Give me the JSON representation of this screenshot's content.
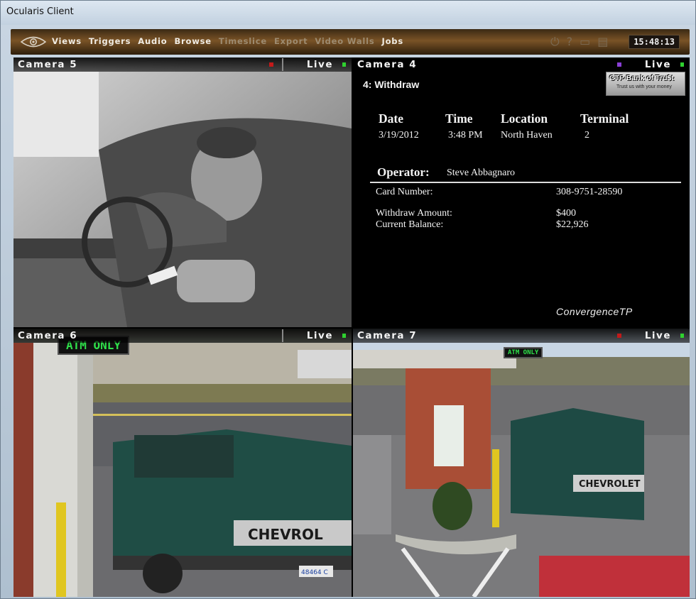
{
  "window": {
    "title": "Ocularis Client"
  },
  "toolbar": {
    "menu": [
      "Views",
      "Triggers",
      "Audio",
      "Browse"
    ],
    "menu_disabled": [
      "Timeslice",
      "Export",
      "Video Walls"
    ],
    "menu_last": "Jobs",
    "clock": "15:48:13",
    "icons": [
      "power-icon",
      "help-icon",
      "monitor-icon",
      "layout-icon"
    ]
  },
  "cameras": [
    {
      "name": "Camera 5",
      "status": "Live"
    },
    {
      "name": "Camera 4",
      "status": "Live"
    },
    {
      "name": "Camera 6",
      "status": "Live"
    },
    {
      "name": "Camera 7",
      "status": "Live"
    }
  ],
  "transaction": {
    "title": "4: Withdraw",
    "bank_logo": "CTP Bank of Tru$t",
    "bank_tagline": "Trust us with your money",
    "headers": [
      "Date",
      "Time",
      "Location",
      "Terminal"
    ],
    "values": [
      "3/19/2012",
      "3:48 PM",
      "North Haven",
      "2"
    ],
    "operator_label": "Operator:",
    "operator": "Steve Abbagnaro",
    "card_label": "Card Number:",
    "card_number": "308-9751-28590",
    "amount_label": "Withdraw Amount:",
    "amount": "$400",
    "balance_label": "Current Balance:",
    "balance": "$22,926",
    "vendor": "ConvergenceTP"
  },
  "signs": {
    "atm": "ATM ONLY",
    "plate_6": "48464 C",
    "truck_6": "CHEVROL",
    "truck_7": "CHEVROLET"
  },
  "colors": {
    "live": "#2fd12f",
    "rec": "#c21a1a",
    "atm_led": "#2fe14a"
  }
}
